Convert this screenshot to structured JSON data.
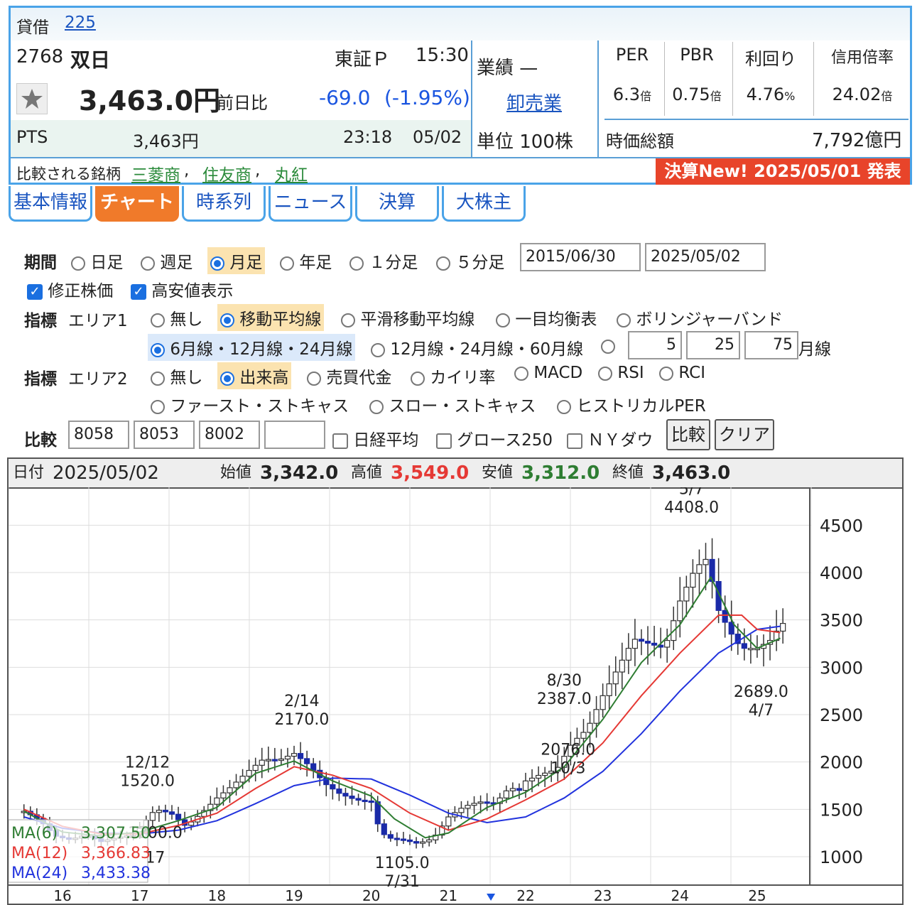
{
  "header": {
    "margin_label": "貸借",
    "margin_value": "225",
    "code": "2768",
    "name": "双日",
    "market": "東証Ｐ",
    "time": "15:30",
    "price": "3,463.0円",
    "change_label": "前日比",
    "change": "-69.0",
    "change_pct": "(-1.95%)",
    "pts_label": "PTS",
    "pts_price": "3,463円",
    "pts_time": "23:18",
    "pts_date": "05/02",
    "gyoseki": "業績 —",
    "sector": "卸売業",
    "unit": "単位 100株",
    "metrics": [
      {
        "label": "PER",
        "value": "6.3",
        "unit": "倍"
      },
      {
        "label": "PBR",
        "value": "0.75",
        "unit": "倍"
      },
      {
        "label": "利回り",
        "value": "4.76",
        "unit": "%"
      },
      {
        "label": "信用倍率",
        "value": "24.02",
        "unit": "倍"
      }
    ],
    "mcap_label": "時価総額",
    "mcap_value": "7,792億円",
    "compare_label": "比較される銘柄",
    "compare_stocks": [
      "三菱商",
      "住友商",
      "丸紅"
    ],
    "news_banner": "決算New! 2025/05/01 発表"
  },
  "tabs": [
    "基本情報",
    "チャート",
    "時系列",
    "ニュース",
    "決算",
    "大株主"
  ],
  "form": {
    "period_label": "期間",
    "periods": [
      "日足",
      "週足",
      "月足",
      "年足",
      "１分足",
      "５分足"
    ],
    "date_from": "2015/06/30",
    "date_to": "2025/05/02",
    "adj_label": "修正株価",
    "hilo_label": "高安値表示",
    "ind_label": "指標",
    "area1_label": "エリア1",
    "area1_opts": [
      "無し",
      "移動平均線",
      "平滑移動平均線",
      "一目均衡表",
      "ボリンジャーバンド"
    ],
    "ma_opts": [
      "6月線・12月線・24月線",
      "12月線・24月線・60月線"
    ],
    "ma_custom": [
      "5",
      "25",
      "75"
    ],
    "ma_custom_unit": "月線",
    "area2_label": "エリア2",
    "area2_opts": [
      "無し",
      "出来高",
      "売買代金",
      "カイリ率",
      "MACD",
      "RSI",
      "RCI"
    ],
    "area2_opts2": [
      "ファースト・ストキャス",
      "スロー・ストキャス",
      "ヒストリカルPER"
    ],
    "cmp_label": "比較",
    "cmp_codes": [
      "8058",
      "8053",
      "8002",
      ""
    ],
    "cmp_checks": [
      "日経平均",
      "グロース250",
      "ＮＹダウ"
    ],
    "cmp_button": "比較",
    "clear_button": "クリア"
  },
  "chart_data": {
    "type": "candlestick",
    "date_label": "日付",
    "date": "2025/05/02",
    "open_label": "始値",
    "open": "3,342.0",
    "high_label": "高値",
    "high": "3,549.0",
    "low_label": "安値",
    "low": "3,312.0",
    "close_label": "終値",
    "close": "3,463.0",
    "ylim": [
      700,
      4900
    ],
    "yticks": [
      "1000",
      "1500",
      "2000",
      "2500",
      "3000",
      "3500",
      "4000",
      "4500"
    ],
    "xticks": [
      "16",
      "17",
      "18",
      "19",
      "20",
      "21",
      "22",
      "23",
      "24",
      "25"
    ],
    "annotations": [
      {
        "date": "12/12",
        "value": "1520.0"
      },
      {
        "date": "2/14",
        "value": "2170.0"
      },
      {
        "date": "7/31",
        "value": "1105.0"
      },
      {
        "date": "8/30",
        "value": "2387.0"
      },
      {
        "date": "10/3",
        "value": "2076.0"
      },
      {
        "date": "5/7",
        "value": "4408.0"
      },
      {
        "date": "4/7",
        "value": "2689.0"
      },
      {
        "date": "",
        "value": "1200.0"
      },
      {
        "date": "17",
        "value": ""
      }
    ],
    "legend": [
      {
        "name": "MA(6)",
        "value": "3,307.50",
        "color": "#2e7d32"
      },
      {
        "name": "MA(12)",
        "value": "3,366.83",
        "color": "#e53935"
      },
      {
        "name": "MA(24)",
        "value": "3,433.38",
        "color": "#2233dd"
      }
    ],
    "price_path": [
      [
        2015.5,
        1480
      ],
      [
        2015.7,
        1390
      ],
      [
        2015.9,
        1220
      ],
      [
        2016.1,
        1180
      ],
      [
        2016.3,
        1230
      ],
      [
        2016.5,
        1160
      ],
      [
        2016.7,
        1200
      ],
      [
        2016.9,
        1230
      ],
      [
        2017.0,
        1300
      ],
      [
        2017.2,
        1500
      ],
      [
        2017.4,
        1460
      ],
      [
        2017.6,
        1320
      ],
      [
        2017.8,
        1460
      ],
      [
        2018.0,
        1620
      ],
      [
        2018.2,
        1750
      ],
      [
        2018.4,
        1900
      ],
      [
        2018.6,
        2030
      ],
      [
        2018.8,
        2020
      ],
      [
        2019.0,
        2090
      ],
      [
        2019.2,
        1960
      ],
      [
        2019.4,
        1770
      ],
      [
        2019.6,
        1660
      ],
      [
        2019.8,
        1600
      ],
      [
        2020.0,
        1580
      ],
      [
        2020.1,
        1300
      ],
      [
        2020.2,
        1200
      ],
      [
        2020.4,
        1180
      ],
      [
        2020.6,
        1140
      ],
      [
        2020.8,
        1190
      ],
      [
        2021.0,
        1420
      ],
      [
        2021.2,
        1530
      ],
      [
        2021.4,
        1580
      ],
      [
        2021.6,
        1560
      ],
      [
        2021.8,
        1740
      ],
      [
        2021.9,
        1680
      ],
      [
        2022.0,
        1800
      ],
      [
        2022.2,
        1870
      ],
      [
        2022.4,
        1920
      ],
      [
        2022.6,
        2200
      ],
      [
        2022.8,
        2350
      ],
      [
        2023.0,
        2700
      ],
      [
        2023.2,
        3000
      ],
      [
        2023.4,
        3300
      ],
      [
        2023.6,
        3250
      ],
      [
        2023.8,
        3200
      ],
      [
        2024.0,
        3700
      ],
      [
        2024.2,
        4050
      ],
      [
        2024.35,
        4150
      ],
      [
        2024.5,
        3600
      ],
      [
        2024.7,
        3300
      ],
      [
        2024.8,
        3200
      ],
      [
        2025.0,
        3200
      ],
      [
        2025.2,
        3300
      ],
      [
        2025.3,
        3463
      ]
    ],
    "ma6": [
      [
        2015.5,
        1480
      ],
      [
        2016.0,
        1260
      ],
      [
        2016.5,
        1220
      ],
      [
        2017.0,
        1260
      ],
      [
        2017.5,
        1380
      ],
      [
        2018.0,
        1520
      ],
      [
        2018.5,
        1880
      ],
      [
        2019.0,
        2010
      ],
      [
        2019.5,
        1800
      ],
      [
        2020.0,
        1640
      ],
      [
        2020.3,
        1400
      ],
      [
        2020.7,
        1200
      ],
      [
        2021.0,
        1250
      ],
      [
        2021.5,
        1520
      ],
      [
        2022.0,
        1680
      ],
      [
        2022.5,
        1950
      ],
      [
        2023.0,
        2450
      ],
      [
        2023.5,
        3050
      ],
      [
        2024.0,
        3450
      ],
      [
        2024.4,
        3950
      ],
      [
        2024.7,
        3450
      ],
      [
        2025.0,
        3200
      ],
      [
        2025.3,
        3307
      ]
    ],
    "ma12": [
      [
        2015.5,
        1500
      ],
      [
        2016.0,
        1320
      ],
      [
        2016.5,
        1240
      ],
      [
        2017.0,
        1240
      ],
      [
        2017.5,
        1330
      ],
      [
        2018.0,
        1460
      ],
      [
        2018.5,
        1720
      ],
      [
        2019.0,
        1950
      ],
      [
        2019.5,
        1860
      ],
      [
        2020.0,
        1720
      ],
      [
        2020.5,
        1460
      ],
      [
        2021.0,
        1280
      ],
      [
        2021.5,
        1400
      ],
      [
        2022.0,
        1600
      ],
      [
        2022.5,
        1820
      ],
      [
        2023.0,
        2200
      ],
      [
        2023.5,
        2700
      ],
      [
        2024.0,
        3150
      ],
      [
        2024.5,
        3550
      ],
      [
        2024.8,
        3550
      ],
      [
        2025.0,
        3400
      ],
      [
        2025.3,
        3366
      ]
    ],
    "ma24": [
      [
        2015.5,
        1420
      ],
      [
        2016.0,
        1300
      ],
      [
        2016.5,
        1250
      ],
      [
        2017.0,
        1240
      ],
      [
        2017.5,
        1280
      ],
      [
        2018.0,
        1380
      ],
      [
        2018.5,
        1560
      ],
      [
        2019.0,
        1750
      ],
      [
        2019.5,
        1830
      ],
      [
        2020.0,
        1820
      ],
      [
        2020.5,
        1650
      ],
      [
        2021.0,
        1460
      ],
      [
        2021.5,
        1360
      ],
      [
        2022.0,
        1420
      ],
      [
        2022.5,
        1620
      ],
      [
        2023.0,
        1900
      ],
      [
        2023.5,
        2300
      ],
      [
        2024.0,
        2750
      ],
      [
        2024.5,
        3150
      ],
      [
        2025.0,
        3400
      ],
      [
        2025.3,
        3433
      ]
    ]
  }
}
